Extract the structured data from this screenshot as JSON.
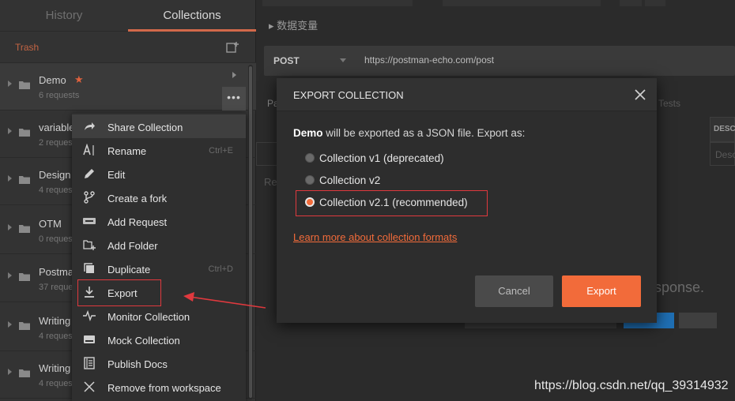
{
  "sidebar": {
    "tabs": [
      {
        "label": "History"
      },
      {
        "label": "Collections"
      }
    ],
    "trash_label": "Trash",
    "collections": [
      {
        "name": "Demo",
        "count": "6 requests",
        "starred": true
      },
      {
        "name": "variable",
        "count": "2 reques"
      },
      {
        "name": "Design",
        "count": "4 reques"
      },
      {
        "name": "OTM",
        "count": "0 reques"
      },
      {
        "name": "Postma",
        "count": "37 reque"
      },
      {
        "name": "Writing",
        "count": "4 reques"
      },
      {
        "name": "Writing",
        "count": "4 reques"
      }
    ],
    "more_label": "•••"
  },
  "context_menu": {
    "items": [
      {
        "label": "Share Collection",
        "shortcut": "",
        "icon": "share-icon"
      },
      {
        "label": "Rename",
        "shortcut": "Ctrl+E",
        "icon": "rename-icon"
      },
      {
        "label": "Edit",
        "shortcut": "",
        "icon": "pencil-icon"
      },
      {
        "label": "Create a fork",
        "shortcut": "",
        "icon": "fork-icon"
      },
      {
        "label": "Add Request",
        "shortcut": "",
        "icon": "get-request-icon"
      },
      {
        "label": "Add Folder",
        "shortcut": "",
        "icon": "add-folder-icon"
      },
      {
        "label": "Duplicate",
        "shortcut": "Ctrl+D",
        "icon": "duplicate-icon"
      },
      {
        "label": "Export",
        "shortcut": "",
        "icon": "download-icon"
      },
      {
        "label": "Monitor Collection",
        "shortcut": "",
        "icon": "pulse-icon"
      },
      {
        "label": "Mock Collection",
        "shortcut": "",
        "icon": "server-icon"
      },
      {
        "label": "Publish Docs",
        "shortcut": "",
        "icon": "doc-icon"
      },
      {
        "label": "Remove from workspace",
        "shortcut": "",
        "icon": "close-icon"
      }
    ]
  },
  "main": {
    "section_label": "数据变量",
    "method": "POST",
    "url": "https://postman-echo.com/post",
    "bg_tab_pa": "Pa",
    "bg_tests": "Tests",
    "bg_desc": "DESC",
    "bg_desc2": "Desc",
    "bg_re": "Re",
    "response_hint": "esponse."
  },
  "modal": {
    "title": "EXPORT COLLECTION",
    "desc_bold": "Demo",
    "desc_rest": " will be exported as a JSON file. Export as:",
    "options": [
      {
        "label": "Collection v1 (deprecated)",
        "selected": false
      },
      {
        "label": "Collection v2",
        "selected": false
      },
      {
        "label": "Collection v2.1 (recommended)",
        "selected": true
      }
    ],
    "learn_more": "Learn more about collection formats",
    "cancel_label": "Cancel",
    "export_label": "Export"
  },
  "watermark": "https://blog.csdn.net/qq_39314932",
  "colors": {
    "accent": "#f26b3a",
    "annotation": "#e0393e",
    "sidebar_bg": "#333333",
    "modal_bg": "#2d2d2d"
  }
}
